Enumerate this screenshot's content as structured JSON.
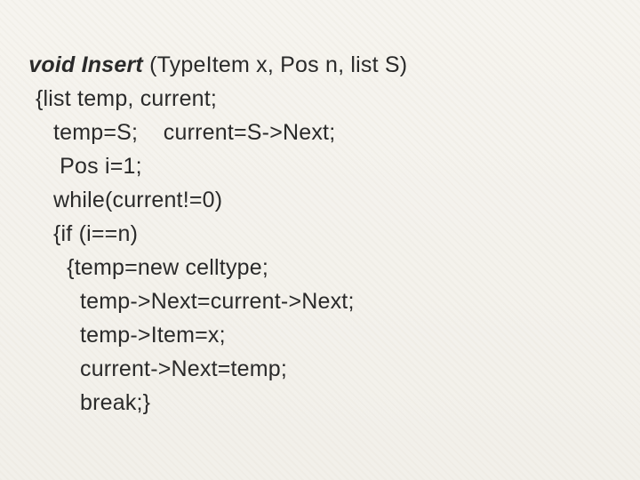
{
  "code": {
    "sig_strong": "void Insert",
    "sig_rest": " (TypeItem x, Pos n, list S)",
    "l2": "{list temp, current;",
    "l3": "temp=S;    current=S->Next;",
    "l4": " Pos i=1;",
    "l5": "while(current!=0)",
    "l6": "{if (i==n)",
    "l7": " {temp=new celltype;",
    "l8": "temp->Next=current->Next;",
    "l9": "temp->Item=x;",
    "l10": "current->Next=temp;",
    "l11": "break;}"
  }
}
